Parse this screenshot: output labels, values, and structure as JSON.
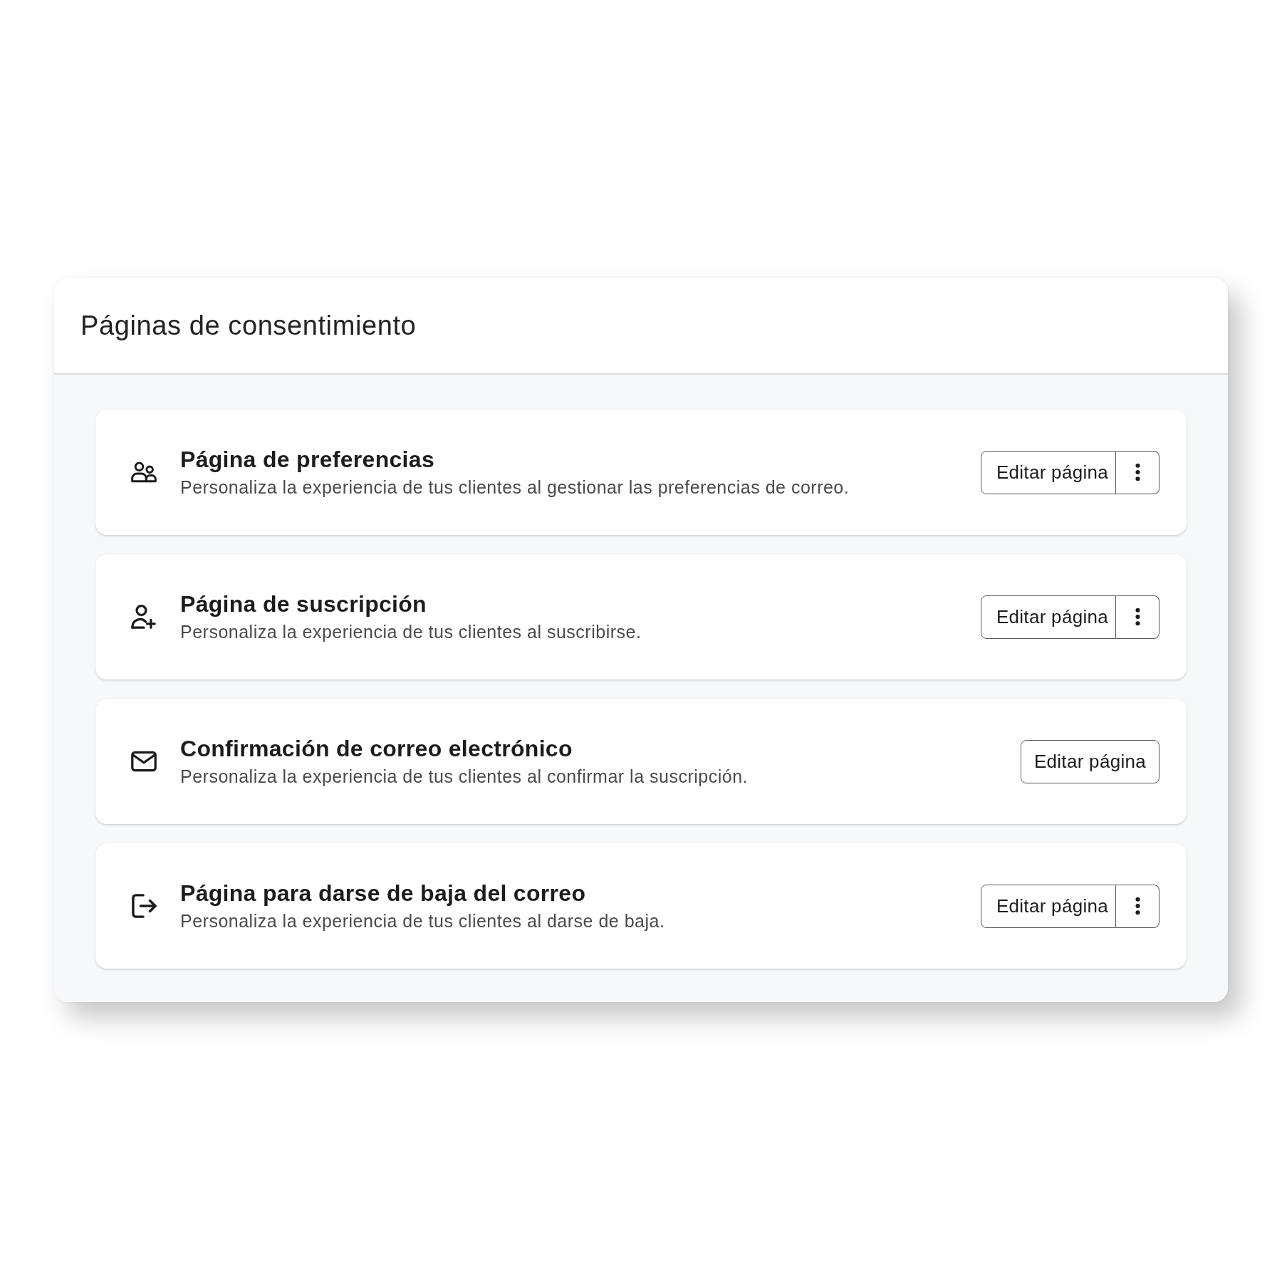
{
  "panel": {
    "title": "Páginas de consentimiento"
  },
  "pages": [
    {
      "title": "Página de preferencias",
      "description": "Personaliza la experiencia de tus clientes al gestionar las preferencias de correo.",
      "button": "Editar página",
      "menu_button": true
    },
    {
      "title": "Página de suscripción",
      "description": "Personaliza la experiencia de tus clientes al suscribirse.",
      "button": "Editar página",
      "menu_button": true
    },
    {
      "title": "Confirmación de correo electrónico",
      "description": "Personaliza la experiencia de tus clientes al confirmar la suscripción.",
      "button": "Editar página",
      "menu_button": false
    },
    {
      "title": "Página para darse de baja del correo",
      "description": "Personaliza la experiencia de tus clientes al darse de baja.",
      "button": "Editar página",
      "menu_button": true
    }
  ]
}
